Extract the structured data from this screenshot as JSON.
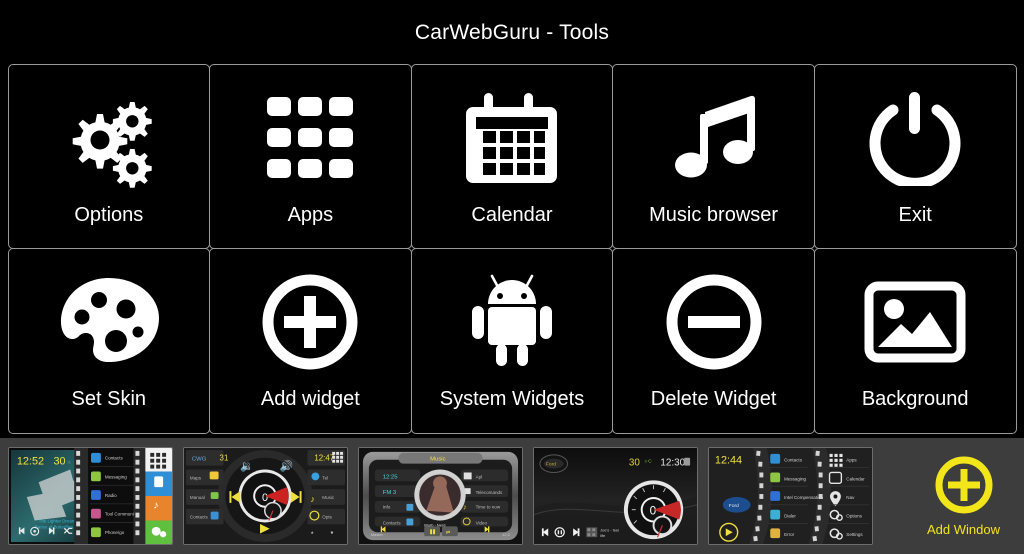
{
  "window": {
    "title": "CarWebGuru - Tools",
    "background_color": "#000000",
    "text_color": "#ffffff"
  },
  "tools_grid": {
    "columns": 5,
    "rows": 2,
    "items": [
      {
        "label": "Options",
        "icon": "gears-icon"
      },
      {
        "label": "Apps",
        "icon": "apps-grid-icon"
      },
      {
        "label": "Calendar",
        "icon": "calendar-icon"
      },
      {
        "label": "Music browser",
        "icon": "music-note-icon"
      },
      {
        "label": "Exit",
        "icon": "power-icon"
      },
      {
        "label": "Set Skin",
        "icon": "palette-icon"
      },
      {
        "label": "Add widget",
        "icon": "plus-circle-icon"
      },
      {
        "label": "System Widgets",
        "icon": "android-robot-icon"
      },
      {
        "label": "Delete Widget",
        "icon": "minus-circle-icon"
      },
      {
        "label": "Background",
        "icon": "image-picture-icon"
      }
    ]
  },
  "window_strip": {
    "background_color": "#3d3d3d",
    "thumbnails": [
      {
        "name": "skin-preview-1",
        "clock": "12:52",
        "temperature": "30",
        "menu_items": [
          "Contacts",
          "Messaging",
          "Radio",
          "Tel Comfort",
          "Phone/go"
        ]
      },
      {
        "name": "skin-preview-2",
        "clock": "12:47",
        "temperature": "31",
        "speed": "0",
        "menu_items": [
          "Maps",
          "Manual",
          "Contacts"
        ]
      },
      {
        "name": "skin-preview-3",
        "clock": "12:25",
        "title": "Music",
        "menu_items": [
          "Apl",
          "Telecomands",
          "Time to now",
          "Video"
        ]
      },
      {
        "name": "skin-preview-4",
        "clock": "12:30",
        "temperature": "30",
        "speed": "0"
      },
      {
        "name": "skin-preview-5",
        "clock": "12:44",
        "menu_items": [
          "Contacts",
          "Messaging",
          "Intel Compensation",
          "Dialer",
          "Error",
          "Apps",
          "Calendar",
          "Nav",
          "Options",
          "Settings"
        ]
      }
    ],
    "add_window": {
      "label": "Add Window",
      "icon": "plus-circle-icon",
      "color": "#f2e61a"
    }
  }
}
